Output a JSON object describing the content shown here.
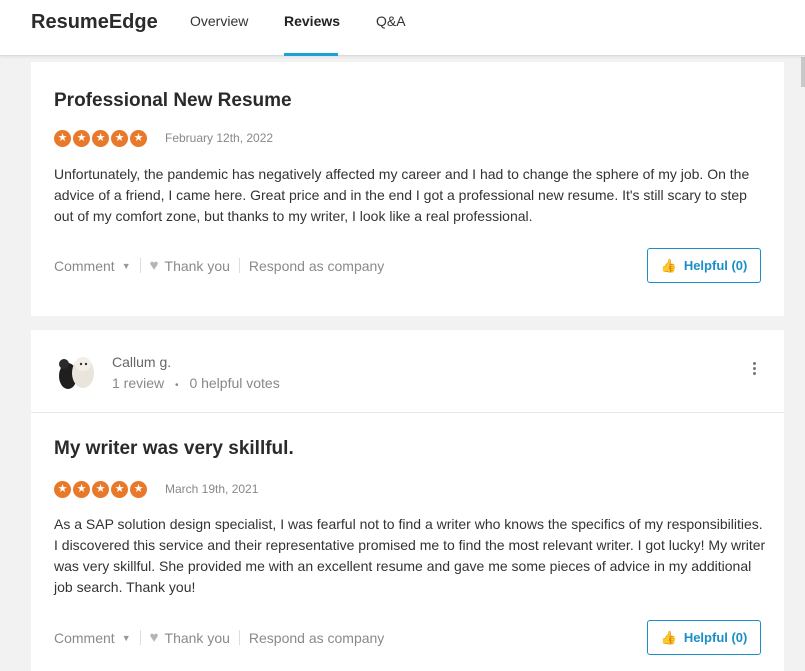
{
  "header": {
    "brand": "ResumeEdge",
    "tabs": [
      {
        "label": "Overview",
        "active": false
      },
      {
        "label": "Reviews",
        "active": true
      },
      {
        "label": "Q&A",
        "active": false
      }
    ],
    "accent_color": "#1aa3d6"
  },
  "reviews": [
    {
      "title": "Professional New Resume",
      "rating": 5,
      "date": "February 12th, 2022",
      "body": "Unfortunately, the pandemic has negatively affected my career and I had to change the sphere of my job. On the advice of a friend, I came here. Great price and in the end I got a professional new resume. It's still scary to step out of my comfort zone, but thanks to my writer, I look like a real professional.",
      "actions": {
        "comment": "Comment",
        "thank": "Thank you",
        "respond": "Respond as company",
        "helpful": "Helpful (0)"
      }
    },
    {
      "author": {
        "name": "Callum g.",
        "reviews": "1 review",
        "votes": "0 helpful votes"
      },
      "title": "My writer was very skillful.",
      "rating": 5,
      "date": "March 19th, 2021",
      "body": "As a SAP solution design specialist, I was fearful not to find a writer who knows the specifics of my responsibilities. I discovered this service and their representative promised me to find the most relevant writer. I got lucky! My writer was very skillful. She provided me with an excellent resume and gave me some pieces of advice in my additional job search. Thank you!",
      "actions": {
        "comment": "Comment",
        "thank": "Thank you",
        "respond": "Respond as company",
        "helpful": "Helpful (0)"
      }
    }
  ],
  "star_color": "#e8792b",
  "icons": {
    "star": "star-icon",
    "heart": "heart-icon",
    "thumb": "thumbs-up-icon",
    "more": "more-vertical-icon",
    "caret": "caret-down-icon"
  }
}
